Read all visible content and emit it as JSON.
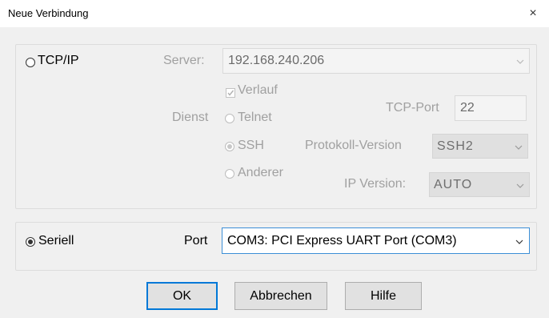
{
  "window": {
    "title": "Neue Verbindung",
    "close_symbol": "×"
  },
  "tcpip": {
    "radio_label": "TCP/IP",
    "server_label": "Server:",
    "server_value": "192.168.240.206",
    "history_label": "Verlauf",
    "service_label": "Dienst",
    "telnet_label": "Telnet",
    "ssh_label": "SSH",
    "other_label": "Anderer",
    "tcp_port_label": "TCP-Port",
    "tcp_port_value": "22",
    "protocol_label": "Protokoll-Version",
    "protocol_value": "SSH2",
    "ip_version_label": "IP Version:",
    "ip_version_value": "AUTO"
  },
  "serial": {
    "radio_label": "Seriell",
    "port_label": "Port",
    "port_value": "COM3: PCI Express UART Port (COM3)"
  },
  "buttons": {
    "ok": "OK",
    "cancel": "Abbrechen",
    "help": "Hilfe"
  },
  "colors": {
    "accent": "#0078d7",
    "disabled_text": "#a0a0a0",
    "dialog_bg": "#f0f0f0"
  }
}
